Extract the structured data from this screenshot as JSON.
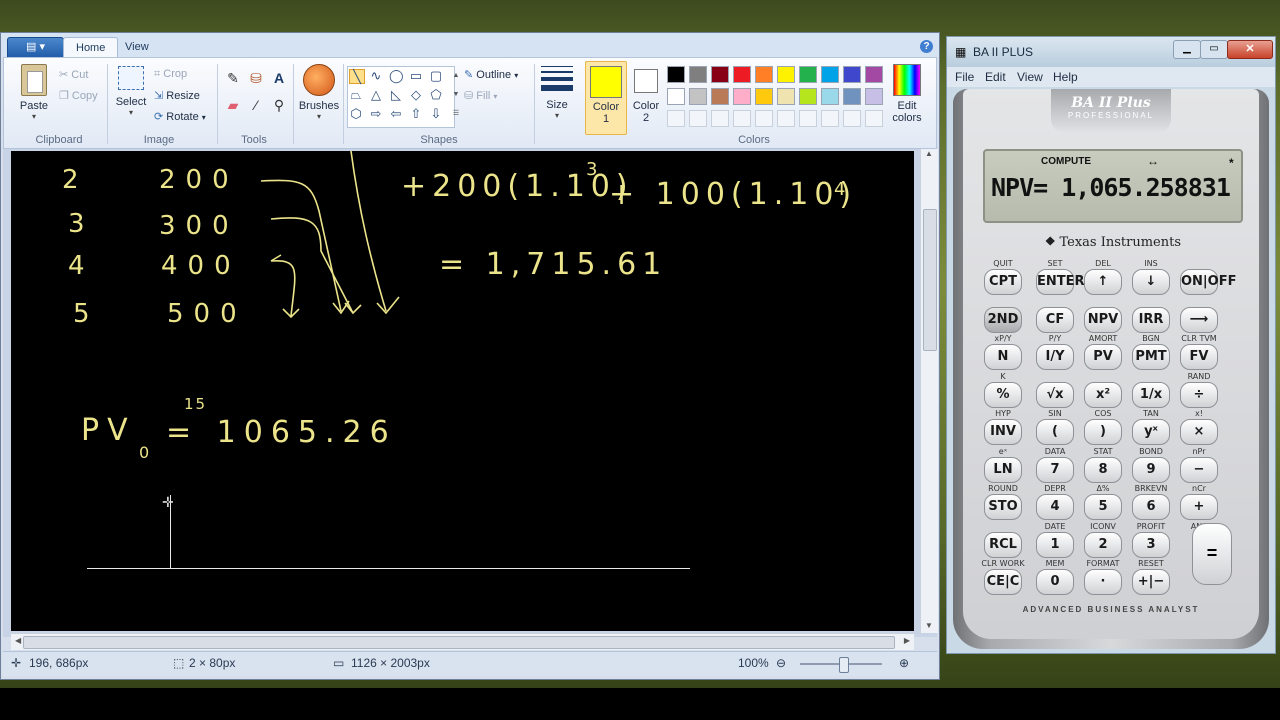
{
  "paint": {
    "app_menu_icon": "paint-menu-icon",
    "tabs": [
      "Home",
      "View"
    ],
    "clipboard": {
      "paste": "Paste",
      "cut": "Cut",
      "copy": "Copy",
      "group": "Clipboard"
    },
    "image": {
      "select": "Select",
      "crop": "Crop",
      "resize": "Resize",
      "rotate": "Rotate",
      "group": "Image"
    },
    "tools": {
      "group": "Tools"
    },
    "brushes": "Brushes",
    "shapes": {
      "outline": "Outline",
      "fill": "Fill",
      "group": "Shapes"
    },
    "size": "Size",
    "color1": {
      "label1": "Color",
      "label2": "1",
      "value": "#ffff00"
    },
    "color2": {
      "label1": "Color",
      "label2": "2",
      "value": "#ffffff"
    },
    "colors_group": "Colors",
    "edit_colors": {
      "line1": "Edit",
      "line2": "colors"
    },
    "palette": [
      "#000000",
      "#7f7f7f",
      "#880015",
      "#ed1c24",
      "#ff7f27",
      "#fff200",
      "#22b14c",
      "#00a2e8",
      "#3f48cc",
      "#a349a4",
      "#ffffff",
      "#c3c3c3",
      "#b97a57",
      "#ffaec9",
      "#ffc90e",
      "#efe4b0",
      "#b5e61d",
      "#99d9ea",
      "#7092be",
      "#c8bfe7"
    ],
    "status": {
      "cursor": "196, 686px",
      "selection": "2 × 80px",
      "image_size": "1126 × 2003px",
      "zoom": "100%"
    }
  },
  "canvas": {
    "rows": [
      {
        "year": "2",
        "amount": "200"
      },
      {
        "year": "3",
        "amount": "300"
      },
      {
        "year": "4",
        "amount": "400"
      },
      {
        "year": "5",
        "amount": "500"
      }
    ],
    "eq1_term1": "+200(1.10)",
    "eq1_exp1": "3",
    "eq1_term2": "+ 100(1.10)",
    "eq1_exp2": "4",
    "eq2": "= 1,715.61",
    "pv_label": "PV",
    "pv_sub": "0",
    "pv_sup": "15",
    "pv_value": "= 1065.26"
  },
  "calculator": {
    "title": "BA II PLUS",
    "menu": [
      "File",
      "Edit",
      "View",
      "Help"
    ],
    "brand_top": "BA II Plus",
    "brand_sub": "PROFESSIONAL",
    "lcd_mode": "COMPUTE",
    "lcd_arrows": "↔",
    "lcd_star": "*",
    "lcd_text": "NPV= 1,065.258831",
    "maker": "Texas Instruments",
    "footer": "ADVANCED BUSINESS ANALYST",
    "rows": [
      {
        "sec": [
          "QUIT",
          "SET",
          "DEL",
          "INS",
          ""
        ],
        "keys": [
          "CPT",
          "ENTER",
          "↑",
          "↓",
          "ON|OFF"
        ]
      },
      {
        "sec": [
          "",
          "",
          "",
          "",
          ""
        ],
        "keys": [
          "2ND",
          "CF",
          "NPV",
          "IRR",
          "⟶"
        ]
      },
      {
        "sec": [
          "xP/Y",
          "P/Y",
          "AMORT",
          "BGN",
          "CLR TVM"
        ],
        "keys": [
          "N",
          "I/Y",
          "PV",
          "PMT",
          "FV"
        ]
      },
      {
        "sec": [
          "K",
          "",
          "",
          "",
          "RAND"
        ],
        "keys": [
          "%",
          "√x",
          "x²",
          "1/x",
          "÷"
        ]
      },
      {
        "sec": [
          "HYP",
          "SIN",
          "COS",
          "TAN",
          "x!"
        ],
        "keys": [
          "INV",
          "(",
          ")",
          "yˣ",
          "×"
        ]
      },
      {
        "sec": [
          "eˣ",
          "DATA",
          "STAT",
          "BOND",
          "nPr"
        ],
        "keys": [
          "LN",
          "7",
          "8",
          "9",
          "−"
        ]
      },
      {
        "sec": [
          "ROUND",
          "DEPR",
          "Δ%",
          "BRKEVN",
          "nCr"
        ],
        "keys": [
          "STO",
          "4",
          "5",
          "6",
          "+"
        ]
      },
      {
        "sec": [
          "",
          "DATE",
          "ICONV",
          "PROFIT",
          "ANS"
        ],
        "keys": [
          "RCL",
          "1",
          "2",
          "3",
          ""
        ]
      },
      {
        "sec": [
          "CLR WORK",
          "MEM",
          "FORMAT",
          "RESET",
          ""
        ],
        "keys": [
          "CE|C",
          "0",
          "·",
          "+|−",
          ""
        ]
      }
    ],
    "equals_key": "="
  }
}
